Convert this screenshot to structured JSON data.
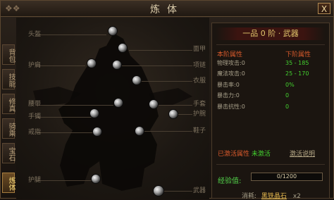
{
  "window": {
    "title": "炼体",
    "close_label": "X"
  },
  "side_tabs": [
    {
      "label": "背包",
      "active": false
    },
    {
      "label": "技能",
      "active": false
    },
    {
      "label": "修真",
      "active": false
    },
    {
      "label": "骑乘",
      "active": false
    },
    {
      "label": "宝石",
      "active": false
    },
    {
      "label": "炼体",
      "active": true
    }
  ],
  "slots_left": [
    "头盔",
    "护肩",
    "腰带",
    "手镯",
    "戒指",
    "护腿"
  ],
  "slots_right": [
    "面甲",
    "项链",
    "衣服",
    "手套",
    "护腕",
    "鞋子",
    "武器"
  ],
  "info": {
    "grade_title": "一品 0 阶 · 武器",
    "current_header": "本阶属性",
    "next_header": "下阶属性",
    "stats": [
      {
        "name": "物理攻击:0",
        "next": "35 - 185"
      },
      {
        "name": "魔法攻击:0",
        "next": "25 - 170"
      },
      {
        "name": "暴击率:0",
        "next": "0%"
      },
      {
        "name": "暴击力:0",
        "next": "0"
      },
      {
        "name": "暴击抗性:0",
        "next": "0"
      }
    ],
    "activated_label": "已激活属性",
    "activated_value": "未激活",
    "activation_link": "激活说明",
    "exp_label": "经验值:",
    "exp_text": "0/1200",
    "exp_progress": 0,
    "consume_label": "消耗:",
    "consume_item": "黑铁晶石",
    "consume_count": "x2"
  },
  "colors": {
    "accent_red": "#d85a2c",
    "green_value": "#43d12f",
    "gold": "#e2c66c"
  }
}
